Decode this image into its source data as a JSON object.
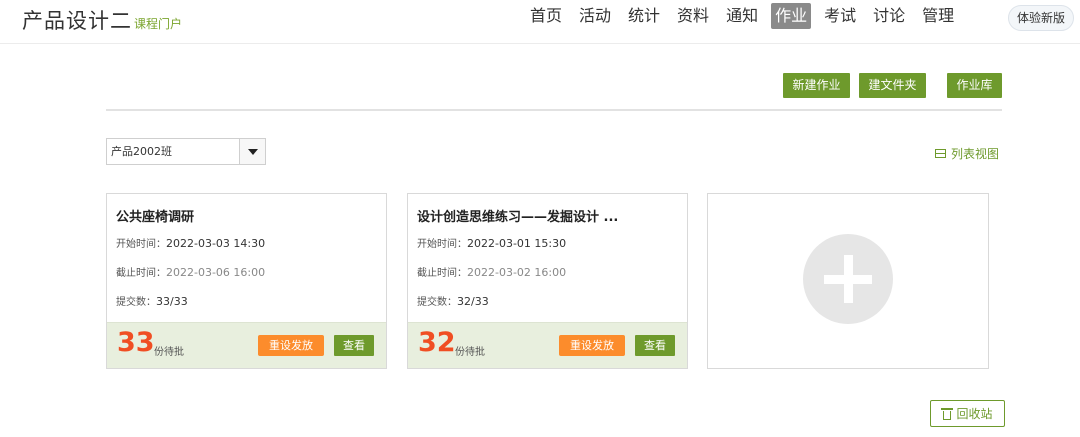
{
  "header": {
    "title": "产品设计二",
    "subtitle": "课程门户",
    "nav": [
      "首页",
      "活动",
      "统计",
      "资料",
      "通知",
      "作业",
      "考试",
      "讨论",
      "管理"
    ],
    "active_nav": "作业",
    "trial_button": "体验新版"
  },
  "toolbar": {
    "new_assignment": "新建作业",
    "new_folder": "建文件夹",
    "assignment_library": "作业库"
  },
  "filter": {
    "class_selected": "产品2002班",
    "list_view_label": "列表视图"
  },
  "assignments": [
    {
      "title": "公共座椅调研",
      "start_label": "开始时间：",
      "start_time": "2022-03-03 14:30",
      "end_label": "截止时间：",
      "end_time": "2022-03-06 16:00",
      "submitted_label": "提交数：",
      "submitted": "33/33",
      "pending_count": "33",
      "pending_label": "份待批",
      "reset_label": "重设发放",
      "view_label": "查看"
    },
    {
      "title": "设计创造思维练习——发掘设计 ...",
      "start_label": "开始时间：",
      "start_time": "2022-03-01 15:30",
      "end_label": "截止时间：",
      "end_time": "2022-03-02 16:00",
      "submitted_label": "提交数：",
      "submitted": "32/33",
      "pending_count": "32",
      "pending_label": "份待批",
      "reset_label": "重设发放",
      "view_label": "查看"
    }
  ],
  "recycle_bin_label": "回收站",
  "colors": {
    "accent_green": "#6e9a2c",
    "orange_button": "#fc8c2c",
    "pending_red": "#f04e23",
    "card_footer": "#e8efde"
  }
}
